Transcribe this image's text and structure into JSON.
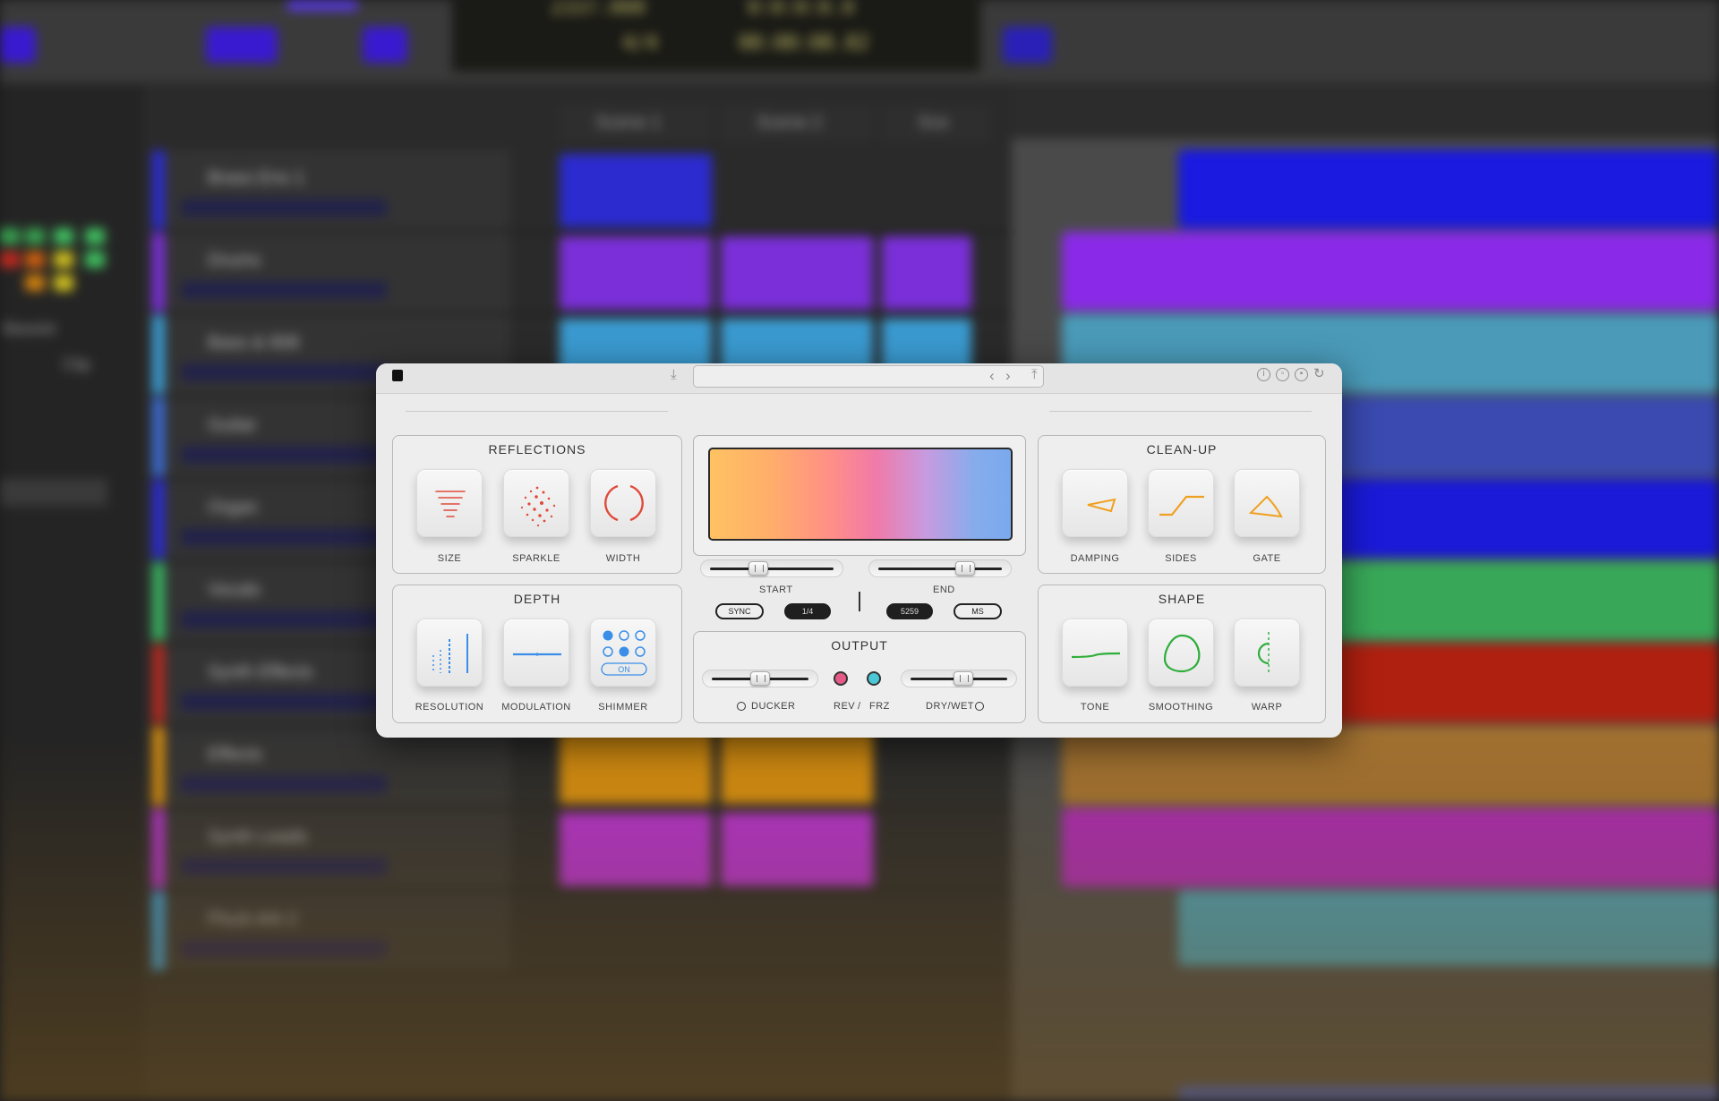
{
  "daw": {
    "lcd_line1": "2337.000",
    "lcd_line2": "4/4",
    "lcd_line3": "00:00:08.82",
    "lcd_line4": "0:0:0:0.0",
    "scenes": [
      "Scene 1",
      "Scene 2",
      "Sce"
    ],
    "tracks": [
      {
        "name": "Brass Ens 1",
        "color": "#2b2bd0"
      },
      {
        "name": "Drums",
        "color": "#7a2fd8"
      },
      {
        "name": "Bass & 808",
        "color": "#3a9ad0"
      },
      {
        "name": "Guitar",
        "color": "#3a6ad0"
      },
      {
        "name": "Organ",
        "color": "#2b2bd0"
      },
      {
        "name": "Vocals",
        "color": "#38b060"
      },
      {
        "name": "Synth Effects",
        "color": "#b02a20"
      },
      {
        "name": "Effects",
        "color": "#d08a10"
      },
      {
        "name": "Synth Leads",
        "color": "#b030c8"
      },
      {
        "name": "Pluck Ark 2",
        "color": "#3a9ad0"
      }
    ],
    "side_text_1": "Bassist",
    "side_text_2": "Clip"
  },
  "plugin": {
    "reflections": {
      "title": "REFLECTIONS",
      "buttons": [
        {
          "label": "SIZE",
          "icon": "size-bars-icon"
        },
        {
          "label": "SPARKLE",
          "icon": "sparkle-dots-icon"
        },
        {
          "label": "WIDTH",
          "icon": "width-brackets-icon"
        }
      ]
    },
    "depth": {
      "title": "DEPTH",
      "buttons": [
        {
          "label": "RESOLUTION",
          "icon": "resolution-lines-icon"
        },
        {
          "label": "MODULATION",
          "icon": "modulation-line-icon"
        },
        {
          "label": "SHIMMER",
          "icon": "shimmer-dots-icon",
          "badge": "ON"
        }
      ]
    },
    "cleanup": {
      "title": "CLEAN-UP",
      "buttons": [
        {
          "label": "DAMPING",
          "icon": "damping-curve-icon"
        },
        {
          "label": "SIDES",
          "icon": "sides-curve-icon"
        },
        {
          "label": "GATE",
          "icon": "gate-shape-icon"
        }
      ]
    },
    "shape": {
      "title": "SHAPE",
      "buttons": [
        {
          "label": "TONE",
          "icon": "tone-line-icon"
        },
        {
          "label": "SMOOTHING",
          "icon": "smoothing-circle-icon"
        },
        {
          "label": "WARP",
          "icon": "warp-curve-icon"
        }
      ]
    },
    "range": {
      "start_label": "START",
      "end_label": "END",
      "start_value": 0.39,
      "end_value": 0.7,
      "sync": "SYNC",
      "division": "1/4",
      "ms_value": "5259",
      "ms": "MS"
    },
    "output": {
      "title": "OUTPUT",
      "ducker": "DUCKER",
      "rev": "REV",
      "slash": "/",
      "frz": "FRZ",
      "drywet": "DRY/WET",
      "ducker_value": 0.5,
      "drywet_value": 0.55
    },
    "colors": {
      "accent_red": "#e04a3a",
      "accent_blue": "#3a8ee8",
      "accent_orange": "#f0a020",
      "accent_green": "#2eae3a",
      "rev_dot": "#e55a86",
      "frz_dot": "#4ac8d8"
    }
  }
}
